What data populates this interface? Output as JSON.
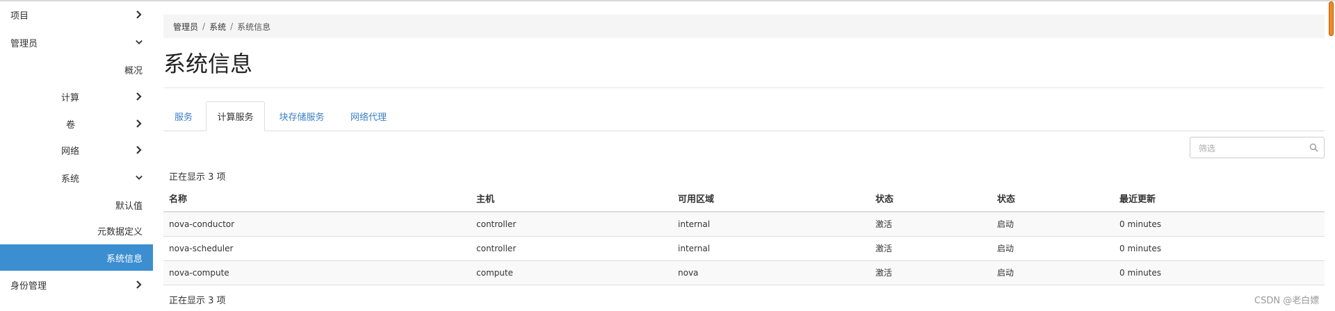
{
  "sidebar": {
    "items": [
      {
        "label": "项目",
        "chevron": "right"
      },
      {
        "label": "管理员",
        "chevron": "down"
      },
      {
        "label": "概况",
        "chevron": ""
      },
      {
        "label": "计算",
        "chevron": "right"
      },
      {
        "label": "卷",
        "chevron": "right"
      },
      {
        "label": "网络",
        "chevron": "right"
      },
      {
        "label": "系统",
        "chevron": "down"
      },
      {
        "label": "默认值",
        "chevron": ""
      },
      {
        "label": "元数据定义",
        "chevron": ""
      },
      {
        "label": "系统信息",
        "chevron": "",
        "active": true
      },
      {
        "label": "身份管理",
        "chevron": "right"
      }
    ]
  },
  "breadcrumb": {
    "items": [
      "管理员",
      "系统",
      "系统信息"
    ],
    "separator": "/"
  },
  "page": {
    "title": "系统信息"
  },
  "tabs": [
    {
      "label": "服务",
      "active": false
    },
    {
      "label": "计算服务",
      "active": true
    },
    {
      "label": "块存储服务",
      "active": false
    },
    {
      "label": "网络代理",
      "active": false
    }
  ],
  "filter": {
    "placeholder": "筛选",
    "value": ""
  },
  "table": {
    "count_text_top": "正在显示 3 项",
    "count_text_bottom": "正在显示 3 项",
    "columns": [
      "名称",
      "主机",
      "可用区域",
      "状态",
      "状态",
      "最近更新"
    ],
    "rows": [
      [
        "nova-conductor",
        "controller",
        "internal",
        "激活",
        "启动",
        "0 minutes"
      ],
      [
        "nova-scheduler",
        "controller",
        "internal",
        "激活",
        "启动",
        "0 minutes"
      ],
      [
        "nova-compute",
        "compute",
        "nova",
        "激活",
        "启动",
        "0 minutes"
      ]
    ]
  },
  "watermark": "CSDN @老白嫖",
  "colors": {
    "accent": "#3b8ed0",
    "link": "#3b7fc4",
    "scrollbar_thumb": "#f08a24"
  }
}
